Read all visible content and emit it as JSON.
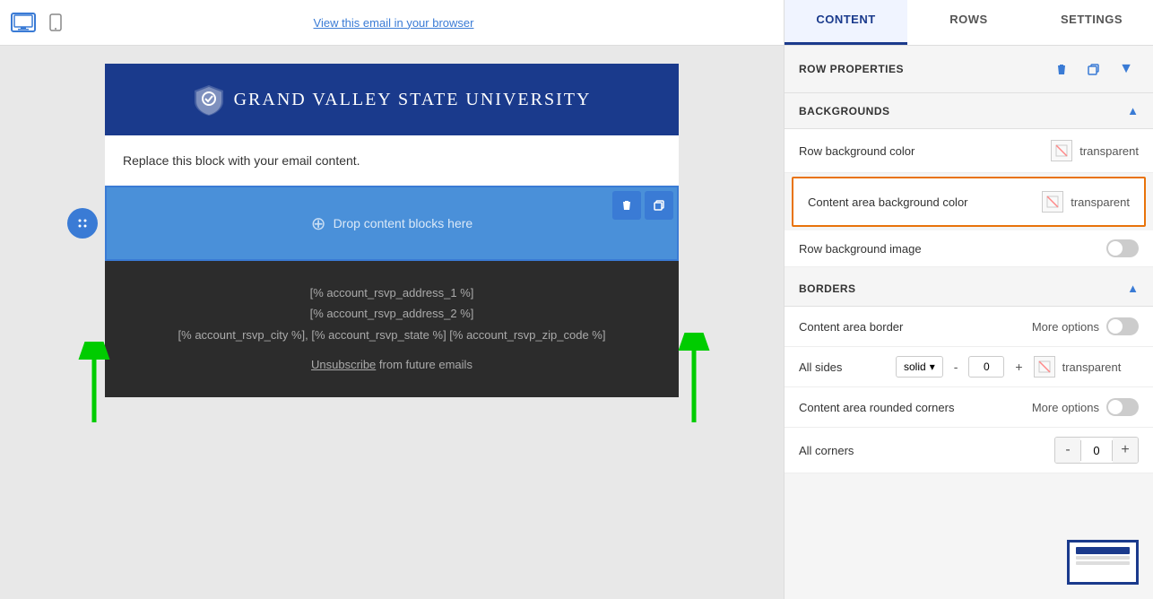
{
  "tabs": {
    "content": "CONTENT",
    "rows": "ROWS",
    "settings": "SETTINGS"
  },
  "toolbar": {
    "view_link": "View this email in your browser"
  },
  "email": {
    "logo_text": "Grand Valley State University",
    "placeholder_text": "Replace this block with your email content.",
    "drop_zone_text": "Drop content blocks here",
    "footer_lines": [
      "[% account_rsvp_address_1 %]",
      "[% account_rsvp_address_2 %]",
      "[% account_rsvp_city %], [% account_rsvp_state %] [% account_rsvp_zip_code %]"
    ],
    "unsubscribe_text": "Unsubscribe",
    "footer_suffix": " from future emails"
  },
  "row_properties": {
    "title": "ROW PROPERTIES",
    "backgrounds_label": "BACKGROUNDS",
    "row_bg_color_label": "Row background color",
    "row_bg_color_value": "transparent",
    "content_area_bg_label": "Content area background color",
    "content_area_bg_value": "transparent",
    "row_bg_image_label": "Row background image",
    "borders_label": "BORDERS",
    "content_area_border_label": "Content area border",
    "more_options_label": "More options",
    "all_sides_label": "All sides",
    "border_style": "solid",
    "border_dash": "-",
    "border_value": "0",
    "border_plus": "+",
    "border_color_value": "transparent",
    "rounded_corners_label": "Content area rounded corners",
    "all_corners_label": "All corners",
    "corners_minus": "-",
    "corners_value": "0",
    "corners_plus": "+"
  },
  "icons": {
    "desktop": "🖥",
    "mobile": "📱",
    "delete": "🗑",
    "copy": "⧉",
    "move": "✥",
    "chevron_up": "▲",
    "chevron_down": "▼",
    "plus_circle": "⊕",
    "dropdown": "▾"
  },
  "colors": {
    "accent_blue": "#1a3a8c",
    "highlight_orange": "#e8730a",
    "tab_active_bg": "#f0f4ff",
    "drop_zone_blue": "#4a90d9"
  }
}
